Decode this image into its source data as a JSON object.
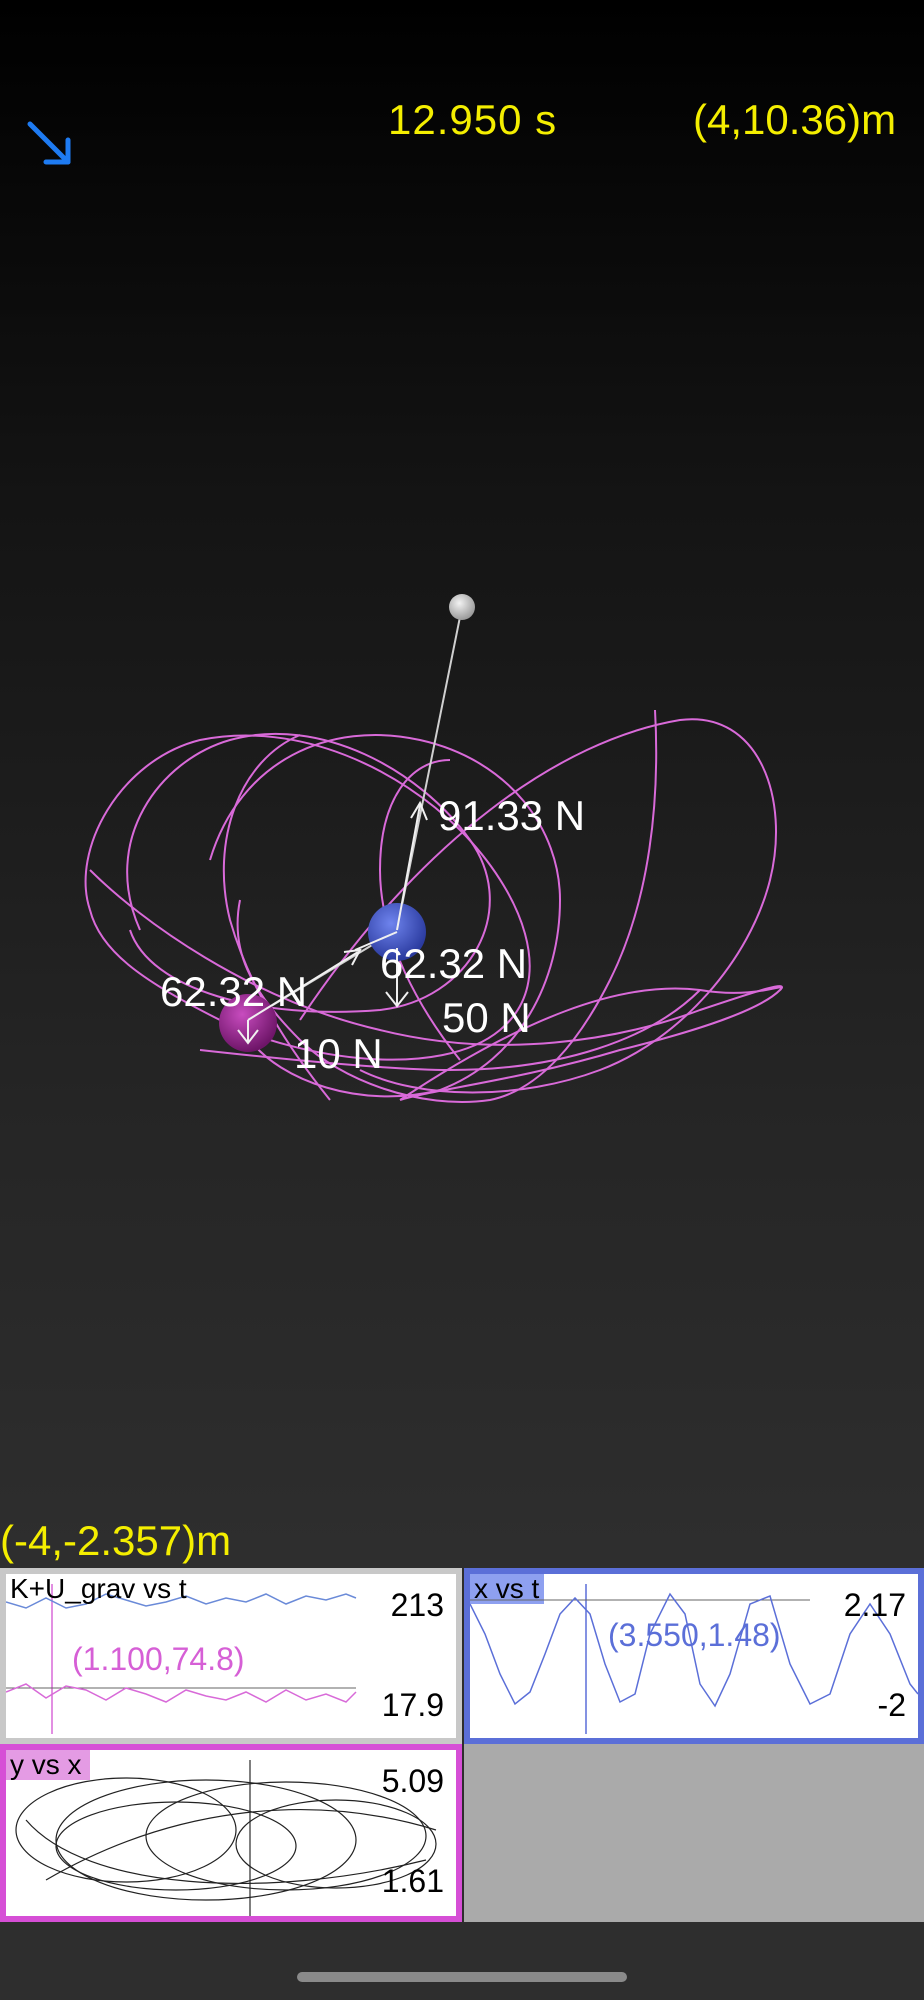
{
  "header": {
    "time": "12.950 s",
    "top_right_coord": "(4,10.36)m",
    "bottom_left_coord": "(-4,-2.357)m",
    "corner_icon": "arrow-down-right-icon",
    "accent_color": "#1e7bf2",
    "coord_color": "#f4ee00"
  },
  "scene": {
    "trail_color": "#d96ad9",
    "force_labels": {
      "tension_upper": "91.33 N",
      "tension_lower_blue": "62.32 N",
      "tension_lower_purple": "62.32 N",
      "weight_blue": "50 N",
      "weight_purple": "10 N"
    },
    "bodies": {
      "pivot_color": "#bdbdbd",
      "upper_bob_color": "#3f54c8",
      "lower_bob_color": "#a7289e"
    }
  },
  "graphs": {
    "energy": {
      "title": "K+U_grav vs t",
      "max": "213",
      "min": "17.9",
      "readout": "(1.100,74.8)",
      "border_color": "#c8c8c8",
      "readout_color": "#d65fd6"
    },
    "x_vs_t": {
      "title": "x vs t",
      "max": "2.17",
      "min": "-2",
      "readout": "(3.550,1.48)",
      "border_color": "#5b6fd8",
      "readout_color": "#5b6fd8"
    },
    "y_vs_x": {
      "title": "y vs x",
      "max": "5.09",
      "min": "1.61",
      "border_color": "#d64fd6"
    }
  }
}
